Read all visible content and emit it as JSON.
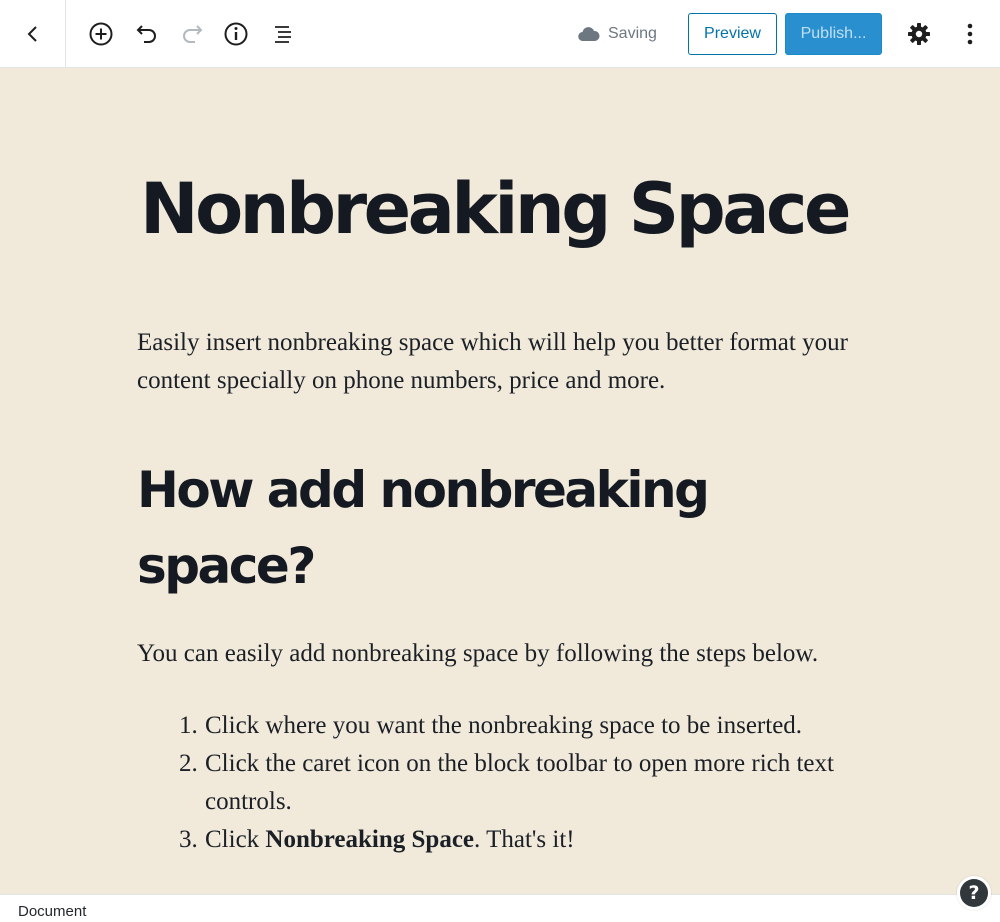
{
  "toolbar": {
    "icons": {
      "back": "chevron-left-icon",
      "add": "plus-circle-icon",
      "undo": "undo-icon",
      "redo": "redo-icon",
      "info": "info-icon",
      "outline": "list-outline-icon",
      "settings": "gear-icon",
      "more": "more-vertical-icon",
      "cloud": "cloud-icon"
    },
    "saving_label": "Saving",
    "preview_label": "Preview",
    "publish_label": "Publish..."
  },
  "post": {
    "title": "Nonbreaking Space",
    "intro": "Easily insert nonbreaking space which will help you better format your content specially on phone numbers, price and more.",
    "heading": "How add nonbreaking space?",
    "steps_intro": "You can easily add nonbreaking space by following the steps below.",
    "steps": [
      {
        "num": "1.",
        "text": "Click where you want the nonbreaking space to be inserted."
      },
      {
        "num": "2.",
        "text": "Click the caret icon on the block toolbar to open more rich text controls."
      },
      {
        "num": "3.",
        "pre": "Click ",
        "bold": "Nonbreaking Space",
        "post": ". That's it!"
      }
    ]
  },
  "footer": {
    "breadcrumb": "Document",
    "help_label": "?"
  },
  "colors": {
    "background": "#f1eadb",
    "accent": "#0073aa",
    "publish_bg": "#2a8fcf",
    "text": "#1b1f26"
  }
}
